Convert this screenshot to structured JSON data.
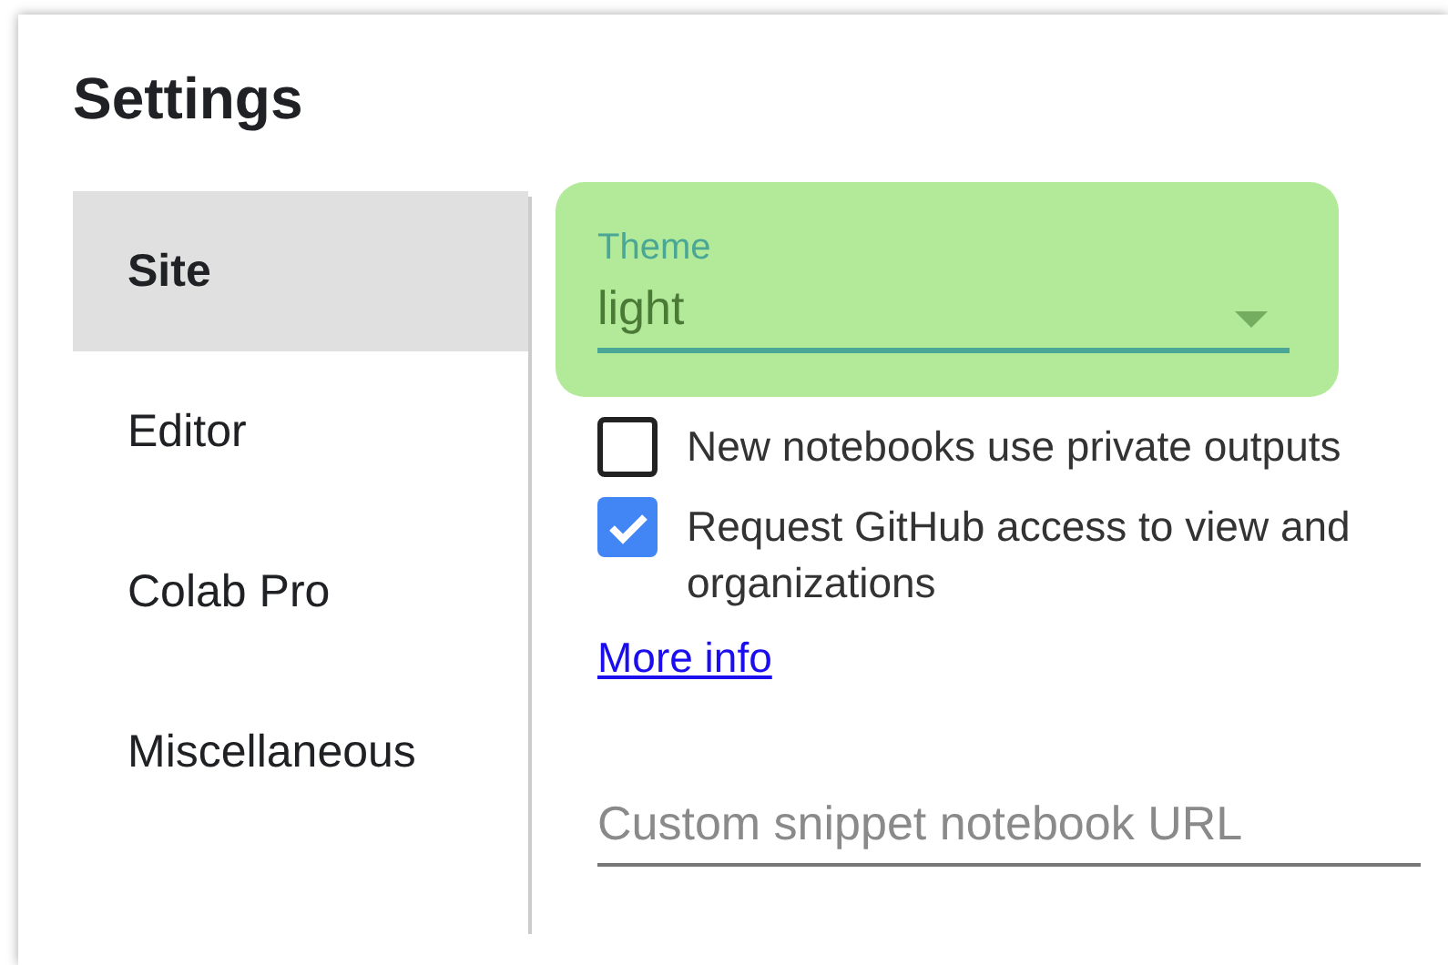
{
  "dialog": {
    "title": "Settings"
  },
  "sidebar": {
    "items": [
      {
        "label": "Site",
        "selected": true
      },
      {
        "label": "Editor",
        "selected": false
      },
      {
        "label": "Colab Pro",
        "selected": false
      },
      {
        "label": "Miscellaneous",
        "selected": false
      }
    ]
  },
  "theme": {
    "label": "Theme",
    "value": "light",
    "highlighted": true
  },
  "options": [
    {
      "lines": [
        "New notebooks use private outputs"
      ],
      "checked": false
    },
    {
      "lines": [
        "Request GitHub access to view and",
        "organizations"
      ],
      "checked": true
    }
  ],
  "more_info": {
    "label": "More info"
  },
  "snippet_field": {
    "placeholder": "Custom snippet notebook URL"
  }
}
